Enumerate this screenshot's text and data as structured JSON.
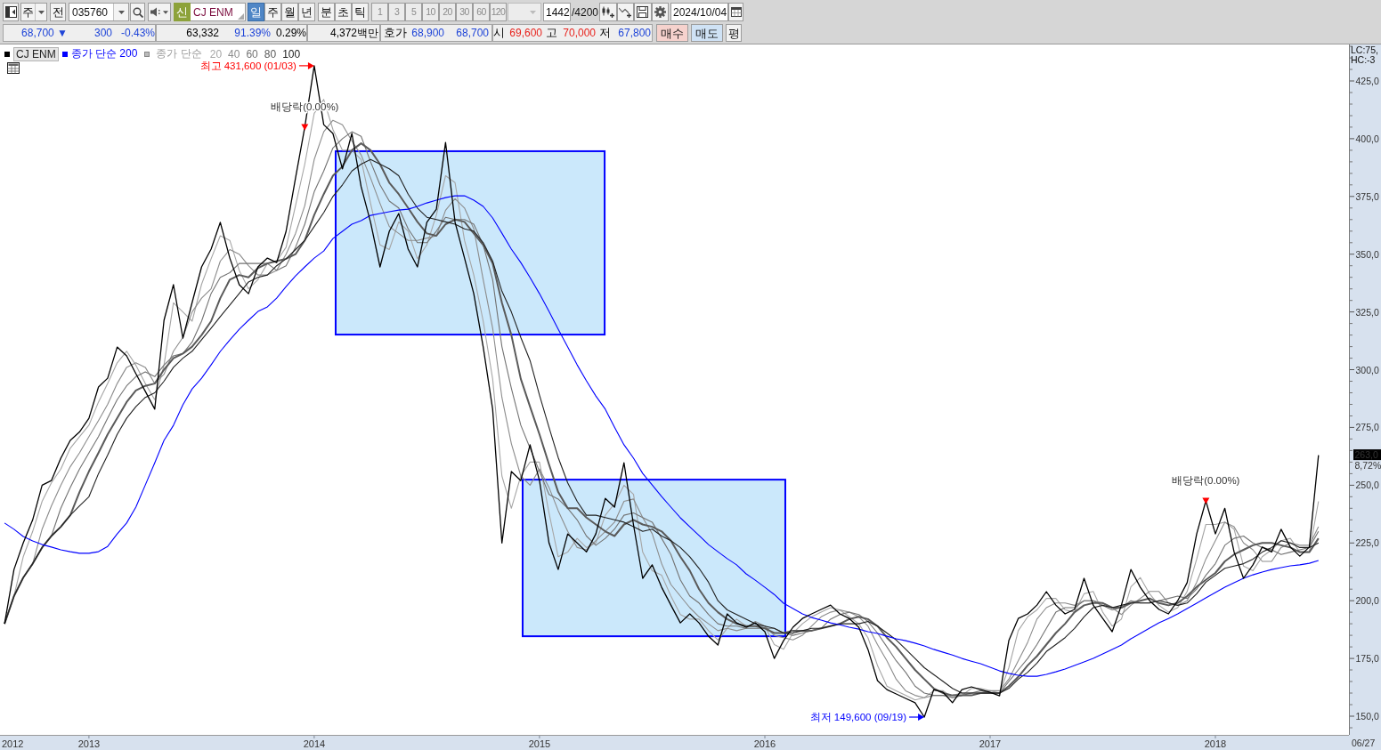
{
  "toolbar": {
    "period_select": "주",
    "prev_button": "전",
    "code_field": "035760",
    "listing_badge": "신",
    "name_field": "CJ ENM",
    "period_tabs": [
      {
        "label": "일",
        "selected": true
      },
      {
        "label": "주",
        "selected": false
      },
      {
        "label": "월",
        "selected": false
      },
      {
        "label": "년",
        "selected": false
      }
    ],
    "time_tabs": [
      {
        "label": "분",
        "selected": false
      },
      {
        "label": "초",
        "selected": false
      },
      {
        "label": "틱",
        "selected": false
      }
    ],
    "interval_buttons": [
      {
        "label": "1",
        "disabled": true
      },
      {
        "label": "3",
        "disabled": true
      },
      {
        "label": "5",
        "disabled": true
      },
      {
        "label": "10",
        "disabled": true
      },
      {
        "label": "20",
        "disabled": true
      },
      {
        "label": "30",
        "disabled": true
      },
      {
        "label": "60",
        "disabled": true
      },
      {
        "label": "120",
        "disabled": true
      }
    ],
    "count_field": "1442",
    "count_total": "/4200",
    "date_field": "2024/10/04"
  },
  "quote_bar": {
    "groups": [
      [
        {
          "kind": "value",
          "text": "68,700 ▼",
          "color": "#1f45d8"
        },
        {
          "kind": "value",
          "text": "300",
          "color": "#1f45d8"
        },
        {
          "kind": "value",
          "text": "-0.43%",
          "color": "#1f45d8"
        }
      ],
      [
        {
          "kind": "value",
          "text": "63,332",
          "color": "#000000"
        },
        {
          "kind": "value",
          "text": "91.39%",
          "color": "#1f45d8"
        },
        {
          "kind": "value",
          "text": "0.29%",
          "color": "#000000"
        }
      ],
      [
        {
          "kind": "value",
          "text": "4,372백만",
          "color": "#000000"
        }
      ],
      [
        {
          "kind": "label",
          "text": "호가"
        },
        {
          "kind": "value",
          "text": "68,900",
          "color": "#1f45d8"
        },
        {
          "kind": "value",
          "text": "68,700",
          "color": "#1f45d8"
        }
      ],
      [
        {
          "kind": "label",
          "text": "시"
        },
        {
          "kind": "value",
          "text": "69,600",
          "color": "#e8231d"
        },
        {
          "kind": "label",
          "text": "고"
        },
        {
          "kind": "value",
          "text": "70,000",
          "color": "#e8231d"
        },
        {
          "kind": "label",
          "text": "저"
        },
        {
          "kind": "value",
          "text": "67,800",
          "color": "#1f45d8"
        }
      ]
    ],
    "buttons": [
      {
        "label": "매수",
        "kind": "buy"
      },
      {
        "label": "매도",
        "kind": "sell"
      },
      {
        "label": "평",
        "kind": "plain"
      }
    ]
  },
  "chart": {
    "legend_label": "종가 단순",
    "axis_info": [
      "LC:75,",
      "HC:-3"
    ],
    "price_marker": {
      "value": "263,0",
      "change": "8,72%"
    },
    "high_label": "최고 431,600 (01/03)",
    "low_label": "최저 149,600 (09/19)",
    "axis_start_label": "2012",
    "last_date": "06/27",
    "drawings": [
      {
        "kind": "rectangle"
      },
      {
        "kind": "rectangle"
      }
    ],
    "chart_data": {
      "type": "line",
      "legend": "top-left",
      "xlim": [
        2012.605,
        2018.593
      ],
      "ylim": [
        141.9,
        440.8
      ],
      "xticks": [
        2013,
        2014,
        2015,
        2016,
        2017,
        2018
      ],
      "yticks": [
        {
          "value": 150,
          "label": "150,0"
        },
        {
          "value": 175,
          "label": "175,0"
        },
        {
          "value": 200,
          "label": "200,0"
        },
        {
          "value": 225,
          "label": "225,0"
        },
        {
          "value": 250,
          "label": "250,0"
        },
        {
          "value": 275,
          "label": "275,0"
        },
        {
          "value": 300,
          "label": "300,0"
        },
        {
          "value": 325,
          "label": "325,0"
        },
        {
          "value": 350,
          "label": "350,0"
        },
        {
          "value": 375,
          "label": "375,0"
        },
        {
          "value": 400,
          "label": "400,0"
        },
        {
          "value": 425,
          "label": "425,0"
        }
      ],
      "x": [
        2012.625,
        2012.667,
        2012.708,
        2012.75,
        2012.792,
        2012.833,
        2012.875,
        2012.917,
        2012.958,
        2013,
        2013.042,
        2013.083,
        2013.125,
        2013.167,
        2013.208,
        2013.25,
        2013.292,
        2013.333,
        2013.375,
        2013.417,
        2013.458,
        2013.5,
        2013.542,
        2013.583,
        2013.625,
        2013.667,
        2013.708,
        2013.75,
        2013.792,
        2013.833,
        2013.875,
        2013.917,
        2013.958,
        2014,
        2014.042,
        2014.083,
        2014.125,
        2014.167,
        2014.208,
        2014.25,
        2014.292,
        2014.333,
        2014.375,
        2014.417,
        2014.458,
        2014.5,
        2014.542,
        2014.583,
        2014.625,
        2014.667,
        2014.708,
        2014.75,
        2014.792,
        2014.833,
        2014.875,
        2014.917,
        2014.958,
        2015,
        2015.042,
        2015.083,
        2015.125,
        2015.167,
        2015.208,
        2015.25,
        2015.292,
        2015.333,
        2015.375,
        2015.417,
        2015.458,
        2015.5,
        2015.542,
        2015.583,
        2015.625,
        2015.667,
        2015.708,
        2015.75,
        2015.792,
        2015.833,
        2015.875,
        2015.917,
        2015.958,
        2016,
        2016.042,
        2016.083,
        2016.125,
        2016.167,
        2016.208,
        2016.25,
        2016.292,
        2016.333,
        2016.375,
        2016.417,
        2016.458,
        2016.5,
        2016.542,
        2016.583,
        2016.625,
        2016.667,
        2016.708,
        2016.75,
        2016.792,
        2016.833,
        2016.875,
        2016.917,
        2016.958,
        2017,
        2017.042,
        2017.083,
        2017.125,
        2017.167,
        2017.208,
        2017.25,
        2017.292,
        2017.333,
        2017.375,
        2017.417,
        2017.458,
        2017.5,
        2017.542,
        2017.583,
        2017.625,
        2017.667,
        2017.708,
        2017.75,
        2017.792,
        2017.833,
        2017.875,
        2017.917,
        2017.958,
        2018,
        2018.042,
        2018.083,
        2018.125,
        2018.167,
        2018.208,
        2018.25,
        2018.292,
        2018.333,
        2018.375,
        2018.417,
        2018.458
      ],
      "series": [
        {
          "name": "CJ ENM",
          "color": "#000000",
          "values": [
            190,
            213.5,
            225,
            235,
            250,
            252,
            261.7,
            269.4,
            273,
            279,
            292.5,
            296.3,
            309.8,
            306,
            298.3,
            290.6,
            282.9,
            321.4,
            336.8,
            313.7,
            329.1,
            344.5,
            352.2,
            363.8,
            348.3,
            336.8,
            332.9,
            344.5,
            348.3,
            346.4,
            359.9,
            383,
            405,
            431.6,
            406.1,
            402.3,
            386.9,
            402.3,
            379.2,
            363.8,
            344.5,
            359.9,
            367.6,
            352.2,
            344.5,
            363.8,
            369.5,
            398.4,
            363.8,
            348.3,
            332.9,
            309.8,
            282.9,
            225,
            255.9,
            252,
            267.5,
            252,
            225,
            213.5,
            228.9,
            225,
            221.1,
            228.9,
            244.3,
            240.5,
            259.7,
            232.8,
            209.7,
            215.5,
            205.8,
            198.1,
            190.4,
            194.3,
            190.4,
            184.6,
            180.8,
            194.3,
            190.4,
            188.5,
            190.4,
            186.6,
            175,
            182.7,
            188.5,
            192.3,
            194.3,
            196.2,
            198.1,
            194.3,
            192.3,
            188.5,
            178.9,
            165.4,
            161.5,
            159.6,
            157.7,
            155.8,
            149.6,
            161.5,
            160.3,
            155.8,
            161.5,
            162.7,
            161.5,
            160.3,
            158.8,
            182.7,
            192.3,
            194.3,
            198.1,
            203.9,
            198.1,
            194.3,
            196.2,
            209.7,
            198.1,
            192.3,
            186.6,
            198.1,
            213.5,
            205.8,
            200,
            196.2,
            194.3,
            200,
            207.8,
            228.9,
            243.2,
            228.9,
            240,
            221.1,
            209.7,
            215.5,
            223.2,
            221.1,
            230.9,
            223.2,
            219.3,
            223.2,
            263
          ]
        },
        {
          "name": "종가 단순 200",
          "color": "#0000ff",
          "values": [
            233.6,
            230.9,
            227.8,
            225.9,
            224.3,
            223.2,
            222,
            221.2,
            220.5,
            220.5,
            221.2,
            223.5,
            228.9,
            233.6,
            240.5,
            250.1,
            259.7,
            269.4,
            275.9,
            284.8,
            291.7,
            296.3,
            302.1,
            307.9,
            312.9,
            317.5,
            321.4,
            325.2,
            327.2,
            331,
            336,
            340.6,
            344.5,
            348.3,
            351.4,
            356.8,
            359.9,
            363,
            364.5,
            366.8,
            367.6,
            368.4,
            369.1,
            369.5,
            370.7,
            372.2,
            373.4,
            374.5,
            375.3,
            375.3,
            373.4,
            370.7,
            365.7,
            359.1,
            352.2,
            346.4,
            339.9,
            332.9,
            325.2,
            317.5,
            309.8,
            302.1,
            295.2,
            288.6,
            282.9,
            275.1,
            267.5,
            261.7,
            255.1,
            250.1,
            245.1,
            240.5,
            235.9,
            232,
            228.2,
            224.3,
            221.2,
            218.2,
            215.5,
            211.6,
            208.9,
            205.8,
            202.7,
            198.9,
            196.6,
            194.3,
            192.7,
            191.6,
            190.4,
            189.6,
            188.5,
            187.7,
            186.6,
            185.8,
            184.6,
            183.5,
            182.7,
            181.6,
            180.4,
            178.9,
            177.7,
            176.5,
            175,
            173.8,
            172.7,
            171.2,
            169.6,
            168.5,
            167.7,
            167.3,
            167.3,
            168.1,
            169.2,
            170.4,
            171.9,
            173.5,
            175,
            176.9,
            178.9,
            180.8,
            183.5,
            185.8,
            188.1,
            190.4,
            192.3,
            194.3,
            196.6,
            198.9,
            201.2,
            203.5,
            205.8,
            207.8,
            209.7,
            211.2,
            212.4,
            213.5,
            214.3,
            215.1,
            215.5,
            216.2,
            217.4
          ]
        },
        {
          "name": "20",
          "color": "#a6a6a6",
          "values": [
            190,
            202,
            219,
            230,
            243,
            251,
            257,
            266,
            271,
            276,
            286,
            294,
            303,
            308,
            302,
            294,
            287,
            302,
            329,
            325,
            321,
            337,
            348,
            358,
            356,
            343,
            335,
            339,
            346,
            347,
            353,
            371,
            389,
            411,
            417,
            404,
            395,
            395,
            391,
            372,
            354,
            352,
            364,
            360,
            348,
            354,
            367,
            384,
            381,
            356,
            341,
            321,
            296,
            254,
            240,
            254,
            260,
            260,
            238,
            219,
            221,
            227,
            223,
            225,
            237,
            242,
            250,
            246,
            221,
            213,
            211,
            202,
            194,
            192,
            192,
            187,
            183,
            188,
            192,
            189,
            189,
            189,
            181,
            179,
            186,
            190,
            193,
            195,
            197,
            196,
            193,
            190,
            184,
            172,
            163,
            161,
            159,
            157,
            158,
            161,
            161,
            158,
            159,
            162,
            162,
            161,
            160,
            171,
            187,
            193,
            196,
            201,
            201,
            196,
            195,
            203,
            204,
            195,
            189,
            192,
            206,
            210,
            203,
            198,
            195,
            197,
            204,
            218,
            233,
            233,
            234,
            231,
            215,
            213,
            219,
            222,
            226,
            227,
            221,
            221,
            243
          ]
        },
        {
          "name": "40",
          "color": "#8c8c8c",
          "values": [
            190,
            202,
            210,
            216,
            231,
            241,
            250,
            258,
            264,
            271,
            278,
            285,
            294,
            301,
            303,
            301,
            294,
            298,
            308,
            314,
            325,
            331,
            335,
            347,
            352,
            350,
            345,
            341,
            341,
            343,
            350,
            359,
            371,
            391,
            403,
            408,
            406,
            399,
            393,
            383,
            372,
            362,
            359,
            356,
            356,
            357,
            358,
            369,
            374,
            370,
            361,
            339,
            318,
            288,
            268,
            254,
            250,
            257,
            249,
            239,
            230,
            223,
            222,
            226,
            230,
            234,
            243,
            244,
            236,
            229,
            216,
            207,
            202,
            197,
            193,
            190,
            187,
            188,
            187,
            188,
            191,
            189,
            185,
            184,
            183,
            185,
            189,
            193,
            195,
            196,
            195,
            193,
            189,
            181,
            174,
            166,
            161,
            159,
            158,
            159,
            159,
            159,
            160,
            160,
            160,
            161,
            161,
            166,
            174,
            182,
            192,
            197,
            199,
            199,
            198,
            200,
            200,
            199,
            197,
            194,
            198,
            201,
            204,
            204,
            199,
            198,
            200,
            208,
            218,
            226,
            234,
            232,
            225,
            222,
            217,
            217,
            223,
            225,
            224,
            224,
            232
          ]
        },
        {
          "name": "60",
          "color": "#737373",
          "values": [
            190,
            202,
            210,
            216,
            223,
            228,
            240,
            249,
            257,
            264,
            271,
            279,
            287,
            293,
            297,
            299,
            297,
            302,
            306,
            307,
            312,
            321,
            333,
            340,
            342,
            346,
            346,
            346,
            346,
            343,
            345,
            353,
            363,
            377,
            386,
            396,
            400,
            403,
            401,
            390,
            380,
            373,
            370,
            361,
            355,
            355,
            360,
            366,
            365,
            365,
            363,
            354,
            339,
            310,
            292,
            276,
            266,
            256,
            246,
            244,
            240,
            235,
            228,
            224,
            227,
            231,
            237,
            238,
            236,
            234,
            227,
            220,
            209,
            202,
            199,
            194,
            190,
            189,
            189,
            188,
            188,
            188,
            188,
            186,
            185,
            186,
            187,
            188,
            192,
            194,
            195,
            194,
            191,
            186,
            180,
            174,
            169,
            163,
            160,
            159,
            159,
            158,
            159,
            160,
            161,
            160,
            160,
            165,
            170,
            175,
            181,
            188,
            195,
            197,
            197,
            200,
            200,
            198,
            196,
            197,
            200,
            199,
            199,
            200,
            201,
            202,
            201,
            205,
            211,
            216,
            224,
            227,
            228,
            225,
            223,
            222,
            220,
            221,
            222,
            223,
            230
          ]
        },
        {
          "name": "80",
          "color": "#5a5a5a",
          "values": [
            190,
            202,
            210,
            216,
            223,
            228,
            232,
            237,
            247,
            256,
            264,
            272,
            279,
            286,
            291,
            293,
            294,
            300,
            305,
            307,
            310,
            315,
            321,
            331,
            339,
            341,
            340,
            344,
            346,
            347,
            348,
            350,
            356,
            367,
            376,
            384,
            388,
            395,
            398,
            395,
            389,
            381,
            376,
            370,
            364,
            359,
            358,
            363,
            365,
            364,
            359,
            354,
            346,
            329,
            315,
            296,
            284,
            272,
            259,
            247,
            240,
            240,
            236,
            233,
            230,
            228,
            233,
            235,
            233,
            232,
            230,
            226,
            219,
            213,
            205,
            199,
            195,
            192,
            190,
            189,
            189,
            188,
            186,
            186,
            187,
            187,
            187,
            188,
            189,
            190,
            192,
            193,
            192,
            189,
            184,
            180,
            175,
            170,
            166,
            162,
            160,
            159,
            159,
            159,
            160,
            160,
            160,
            163,
            167,
            172,
            176,
            181,
            186,
            190,
            195,
            198,
            199,
            199,
            197,
            197,
            199,
            200,
            201,
            199,
            198,
            199,
            202,
            206,
            209,
            212,
            217,
            220,
            222,
            224,
            225,
            225,
            224,
            223,
            221,
            221,
            227
          ]
        },
        {
          "name": "100",
          "color": "#202020",
          "values": [
            190,
            202,
            210,
            216,
            223,
            228,
            232,
            237,
            241,
            245,
            255,
            263,
            272,
            279,
            284,
            288,
            290,
            295,
            301,
            305,
            308,
            313,
            318,
            323,
            328,
            333,
            338,
            340,
            341,
            345,
            348,
            352,
            356,
            362,
            368,
            375,
            380,
            386,
            389,
            391,
            389,
            387,
            384,
            376,
            370,
            366,
            365,
            364,
            363,
            361,
            360,
            355,
            347,
            334,
            325,
            314,
            304,
            289,
            275,
            262,
            251,
            243,
            237,
            237,
            236,
            235,
            234,
            232,
            230,
            231,
            228,
            226,
            223,
            219,
            214,
            208,
            200,
            196,
            194,
            192,
            190,
            189,
            188,
            186,
            186,
            187,
            188,
            188,
            189,
            190,
            190,
            190,
            191,
            189,
            186,
            183,
            179,
            175,
            171,
            168,
            165,
            162,
            160,
            160,
            160,
            160,
            160,
            162,
            166,
            169,
            173,
            178,
            181,
            184,
            188,
            193,
            197,
            198,
            197,
            198,
            199,
            199,
            199,
            200,
            199,
            198,
            199,
            203,
            208,
            211,
            214,
            215,
            216,
            218,
            221,
            223,
            226,
            225,
            223,
            223,
            225
          ]
        }
      ],
      "annotations": [
        {
          "text": "배당락(0.00%)",
          "x": 2013.958,
          "y": 405
        },
        {
          "text": "배당락(0.00%)",
          "x": 2017.958,
          "y": 243.2
        }
      ]
    }
  }
}
